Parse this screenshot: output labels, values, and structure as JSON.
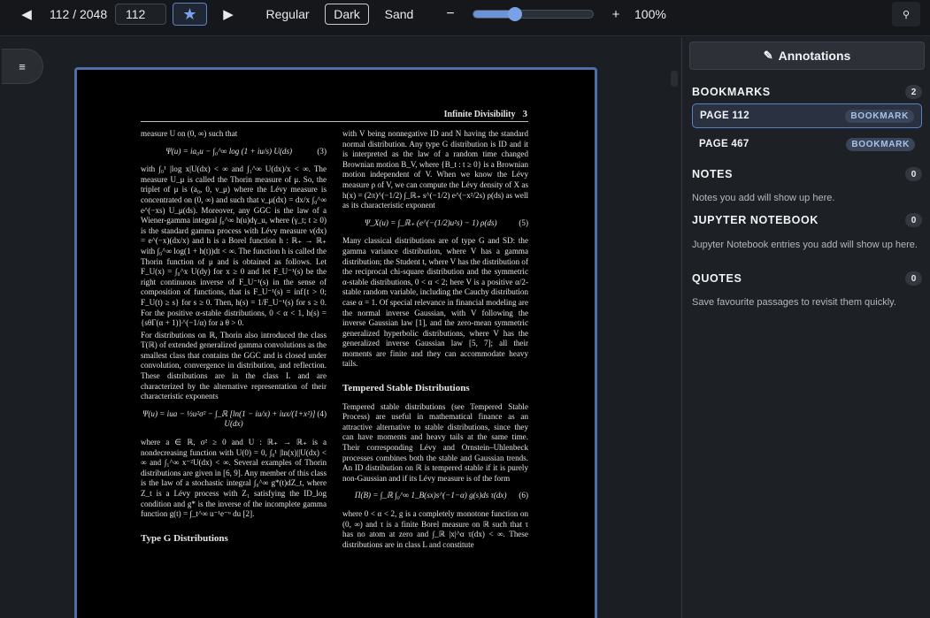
{
  "toolbar": {
    "prev_icon": "◀",
    "page_count": "112 / 2048",
    "page_input": "112",
    "star_icon": "★",
    "next_icon": "▶",
    "themes": {
      "regular": "Regular",
      "dark": "Dark",
      "sand": "Sand"
    },
    "active_theme": "Dark",
    "zoom_minus": "−",
    "zoom_plus": "+",
    "zoom_label": "100%",
    "zoom_level": 0.35,
    "search_icon": "⚲",
    "accent_color": "#6b93d8"
  },
  "document": {
    "menu_icon": "≡",
    "running_title": "Infinite Divisibility",
    "page_number": "3",
    "left_column": [
      {
        "kind": "p",
        "text": "measure U on (0, ∞) such that"
      },
      {
        "kind": "eq",
        "text": "Ψ(u) = ia₀u − ∫₀^∞ log (1 + iu/s) U(ds)",
        "tag": "(3)"
      },
      {
        "kind": "p",
        "text": "with ∫₀¹ |log x|U(dx) < ∞ and ∫₁^∞ U(dx)/x < ∞. The measure U_μ is called the Thorin measure of μ. So, the triplet of μ is (a₀, 0, ν_μ) where the Lévy measure is concentrated on (0, ∞) and such that ν_μ(dx) = dx/x ∫₀^∞ e^(−xs) U_μ(ds). Moreover, any GGC is the law of a Wiener-gamma integral ∫₀^∞ h(u)dγ_u, where (γ_t; t ≥ 0) is the standard gamma process with Lévy measure ν(dx) = e^(−x)(dx/x) and h is a Borel function h : ℝ₊ → ℝ₊ with ∫₀^∞ log(1 + h(t))dt < ∞. The function h is called the Thorin function of μ and is obtained as follows. Let F_U(x) = ∫₀^x U(dy) for x ≥ 0 and let F_U⁻¹(s) be the right continuous inverse of F_U⁻¹(s) in the sense of composition of functions, that is F_U⁻¹(s) = inf{t > 0; F_U(t) ≥ s} for s ≥ 0. Then, h(s) = 1/F_U⁻¹(s) for s ≥ 0. For the positive α-stable distributions, 0 < α < 1, h(s) = {sθΓ(α + 1)}^(−1/α) for a θ > 0."
      },
      {
        "kind": "p",
        "text": "For distributions on ℝ, Thorin also introduced the class T(ℝ) of extended generalized gamma convolutions as the smallest class that contains the GGC and is closed under convolution, convergence in distribution, and reflection. These distributions are in the class L and are characterized by the alternative representation of their characteristic exponents"
      },
      {
        "kind": "eq",
        "text": "Ψ(u) = iua − ½u²σ²  − ∫_ℝ [ln(1 − iu/x) + iux/(1+x²)] U(dx)",
        "tag": "(4)"
      },
      {
        "kind": "p",
        "text": "where a ∈ ℝ, σ² ≥ 0 and U : ℝ₊ → ℝ₊ is a nondecreasing function with U(0) = 0, ∫₀¹ |ln(x)||U(dx) < ∞ and ∫₁^∞ x⁻²U(dx) < ∞. Several examples of Thorin distributions are given in [6, 9]. Any member of this class is the law of a stochastic integral ∫₀^∞ g*(t)dZ_t, where Z_t is a Lévy process with Z₁ satisfying the ID_log condition and g* is the inverse of the incomplete gamma function g(t) = ∫_t^∞ u⁻¹e⁻ᵘ du [2]."
      },
      {
        "kind": "h",
        "text": "Type G Distributions"
      }
    ],
    "right_column": [
      {
        "kind": "p",
        "text": "with V being nonnegative ID and N having the standard normal distribution. Any type G distribution is ID and it is interpreted as the law of a random time changed Brownian motion B_V, where {B_t : t ≥ 0} is a Brownian motion independent of V. When we know the Lévy measure ρ of V, we can compute the Lévy density of X as h(x) = (2π)^(−1/2) ∫_ℝ₊ s^(−1/2) e^(−x²/2s) ρ(ds) as well as its characteristic exponent"
      },
      {
        "kind": "eq",
        "text": "Ψ_X(u) = ∫_ℝ₊ (e^(−(1/2)u²s) − 1) ρ(ds)",
        "tag": "(5)"
      },
      {
        "kind": "p",
        "text": "Many classical distributions are of type G and SD: the gamma variance distribution, where V has a gamma distribution; the Student t, where V has the distribution of the reciprocal chi-square distribution and the symmetric α-stable distributions, 0 < α < 2; here V is a positive α/2-stable random variable, including the Cauchy distribution case α = 1. Of special relevance in financial modeling are the normal inverse Gaussian, with V following the inverse Gaussian law [1], and the zero-mean symmetric generalized hyperbolic distributions, where V has the generalized inverse Gaussian law [5, 7]; all their moments are finite and they can accommodate heavy tails."
      },
      {
        "kind": "h",
        "text": "Tempered Stable Distributions"
      },
      {
        "kind": "p",
        "text": "Tempered stable distributions (see Tempered Stable Process) are useful in mathematical finance as an attractive alternative to stable distributions, since they can have moments and heavy tails at the same time. Their corresponding Lévy and Ornstein–Uhlenbeck processes combines both the stable and Gaussian trends. An ID distribution on ℝ is tempered stable if it is purely non-Gaussian and if its Lévy measure is of the form"
      },
      {
        "kind": "eq",
        "text": "Π(B) = ∫_ℝ ∫₀^∞ 1_B(sx)s^(−1−α) g(s)ds τ(dx)",
        "tag": "(6)"
      },
      {
        "kind": "p",
        "text": "where 0 < α < 2, g is a completely monotone function on (0, ∞) and τ is a finite Borel measure on ℝ such that τ has no atom at zero and ∫_ℝ |x|^α τ(dx) < ∞. These distributions are in class L and constitute"
      }
    ]
  },
  "sidebar": {
    "pencil_icon": "✎",
    "annotations_label": "Annotations",
    "bookmarks_title": "BOOKMARKS",
    "bookmarks_count": "2",
    "bookmarks": [
      {
        "label": "PAGE 112",
        "badge": "BOOKMARK"
      },
      {
        "label": "PAGE 467",
        "badge": "BOOKMARK"
      }
    ],
    "notes_title": "NOTES",
    "notes_count": "0",
    "notes_empty": "Notes you add will show up here.",
    "jupyter_title": "JUPYTER NOTEBOOK",
    "jupyter_count": "0",
    "jupyter_empty": "Jupyter Notebook entries you add will show up here.",
    "quotes_title": "QUOTES",
    "quotes_count": "0",
    "quotes_empty": "Save favourite passages to revisit them quickly."
  }
}
